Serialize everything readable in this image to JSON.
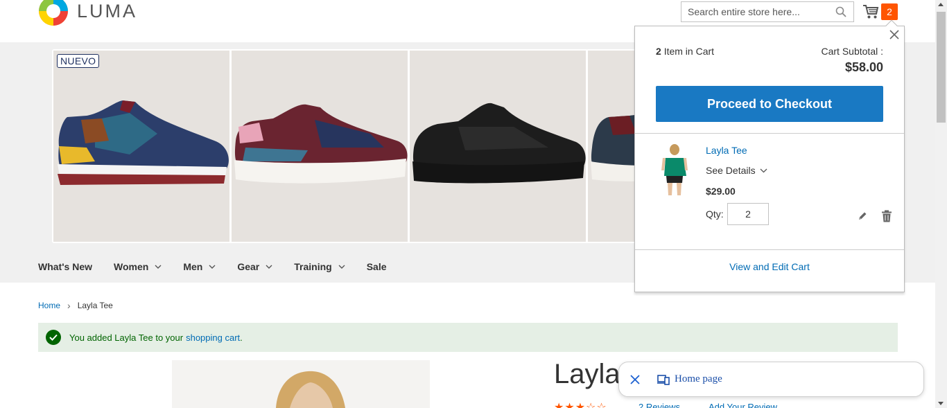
{
  "header": {
    "logo_text": "LUMA",
    "search_placeholder": "Search entire store here...",
    "cart_count": "2"
  },
  "banner": {
    "badge": "NUEVO"
  },
  "nav": {
    "items": [
      {
        "label": "What's New",
        "has_dropdown": false
      },
      {
        "label": "Women",
        "has_dropdown": true
      },
      {
        "label": "Men",
        "has_dropdown": true
      },
      {
        "label": "Gear",
        "has_dropdown": true
      },
      {
        "label": "Training",
        "has_dropdown": true
      },
      {
        "label": "Sale",
        "has_dropdown": false
      }
    ]
  },
  "breadcrumb": {
    "home": "Home",
    "current": "Layla Tee"
  },
  "message": {
    "prefix": "You added Layla Tee to your",
    "link": "shopping cart",
    "suffix": "."
  },
  "product": {
    "title": "Layla",
    "stars": "★★★☆☆",
    "reviews": "2  Reviews",
    "add_review": "Add Your Review"
  },
  "minicart": {
    "count": "2",
    "count_label": "Item in Cart",
    "subtotal_label": "Cart Subtotal :",
    "subtotal": "$58.00",
    "checkout_label": "Proceed to Checkout",
    "item": {
      "name": "Layla Tee",
      "details_label": "See Details",
      "price": "$29.00",
      "qty_label": "Qty:",
      "qty": "2"
    },
    "view_edit_label": "View and Edit Cart"
  },
  "pill": {
    "label": "Home page"
  },
  "colors": {
    "accent_blue": "#1979c3",
    "link_blue": "#006bb4",
    "cart_badge": "#ff5501",
    "success_bg": "#e5efe5",
    "success_text": "#006400"
  }
}
